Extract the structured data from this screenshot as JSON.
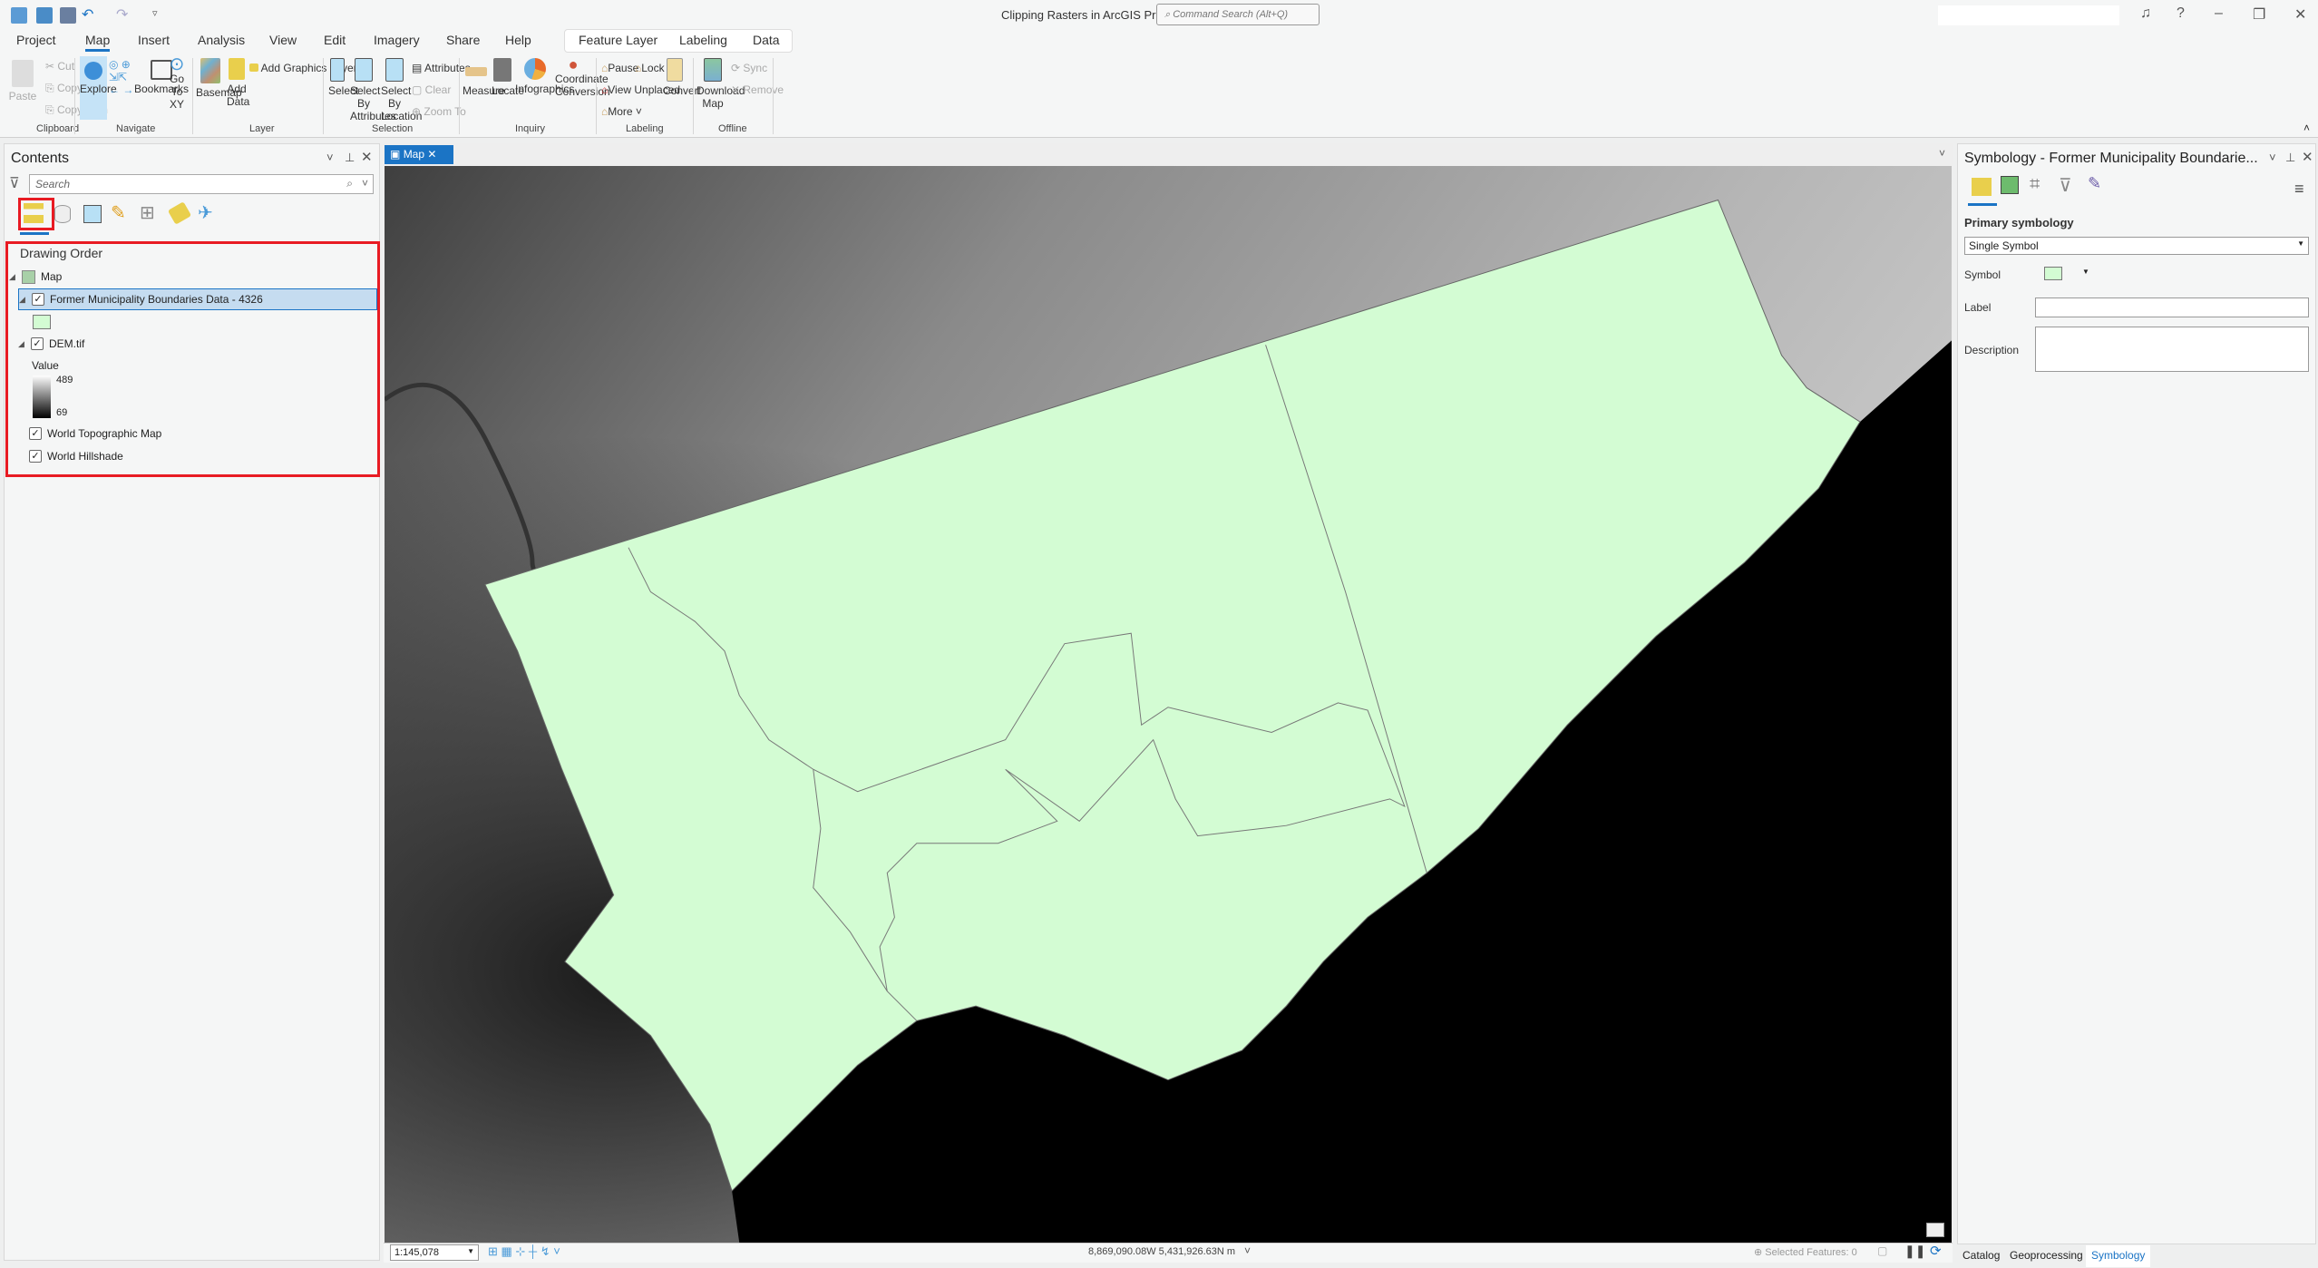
{
  "app": {
    "title": "Clipping Rasters in ArcGIS Pro",
    "command_search_placeholder": "Command Search (Alt+Q)"
  },
  "quick_access": [
    "new-project-icon",
    "open-project-icon",
    "save-icon",
    "undo-icon",
    "redo-icon",
    "customize-icon"
  ],
  "tabs": [
    {
      "label": "Project"
    },
    {
      "label": "Map",
      "active": true
    },
    {
      "label": "Insert"
    },
    {
      "label": "Analysis"
    },
    {
      "label": "View"
    },
    {
      "label": "Edit"
    },
    {
      "label": "Imagery"
    },
    {
      "label": "Share"
    },
    {
      "label": "Help"
    }
  ],
  "context_tabs": [
    {
      "label": "Feature Layer"
    },
    {
      "label": "Labeling"
    },
    {
      "label": "Data"
    }
  ],
  "ribbon": {
    "clipboard": {
      "label": "Clipboard",
      "paste": "Paste",
      "cut": "Cut",
      "copy": "Copy",
      "copy_path": "Copy Path"
    },
    "navigate": {
      "label": "Navigate",
      "explore": "Explore",
      "bookmarks": "Bookmarks",
      "go_to_xy": "Go To XY"
    },
    "layer": {
      "label": "Layer",
      "basemap": "Basemap",
      "add_data": "Add Data",
      "add_graphics_layer": "Add Graphics Layer"
    },
    "selection": {
      "label": "Selection",
      "select": "Select",
      "select_by_attributes": "Select By Attributes",
      "select_by_location": "Select By Location",
      "attributes": "Attributes",
      "clear": "Clear",
      "zoom_to": "Zoom To"
    },
    "inquiry": {
      "label": "Inquiry",
      "measure": "Measure",
      "locate": "Locate",
      "infographics": "Infographics",
      "coordinate_conversion": "Coordinate Conversion"
    },
    "labeling": {
      "label": "Labeling",
      "pause": "Pause",
      "lock": "Lock",
      "view_unplaced": "View Unplaced",
      "more": "More",
      "convert": "Convert"
    },
    "offline": {
      "label": "Offline",
      "download_map": "Download Map",
      "sync": "Sync",
      "remove": "Remove"
    }
  },
  "contents": {
    "title": "Contents",
    "search_placeholder": "Search",
    "section": "Drawing Order",
    "map": "Map",
    "layers": [
      {
        "name": "Former Municipality Boundaries Data - 4326",
        "checked": true,
        "selected": true,
        "swatch": "#d3fcd3"
      },
      {
        "name": "DEM.tif",
        "checked": true,
        "legend_title": "Value",
        "max": "489",
        "min": "69"
      },
      {
        "name": "World Topographic Map",
        "checked": true
      },
      {
        "name": "World Hillshade",
        "checked": true
      }
    ]
  },
  "map_tab": {
    "label": "Map"
  },
  "status": {
    "scale": "1:145,078",
    "coordinates": "8,869,090.08W 5,431,926.63N m",
    "selected_features": "Selected Features: 0"
  },
  "symbology": {
    "title": "Symbology - Former Municipality Boundarie...",
    "primary": "Primary symbology",
    "method": "Single Symbol",
    "symbol_label": "Symbol",
    "symbol_color": "#d3fcd3",
    "label_label": "Label",
    "label_value": "",
    "description_label": "Description",
    "description_value": ""
  },
  "bottom_tabs": [
    {
      "label": "Catalog"
    },
    {
      "label": "Geoprocessing"
    },
    {
      "label": "Symbology",
      "active": true
    }
  ],
  "colors": {
    "accent": "#1b74c5",
    "polygon_fill": "#d3fcd3",
    "highlight": "#e81b23"
  }
}
